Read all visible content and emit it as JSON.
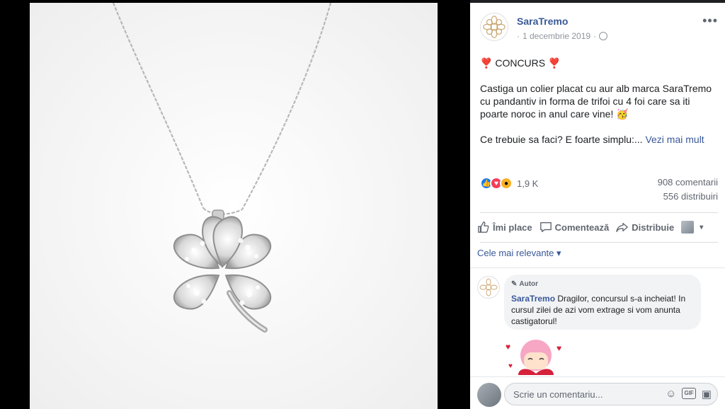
{
  "post": {
    "author": "SaraTremo",
    "date": "1 decembrie 2019",
    "more_icon": "•••",
    "heart_emoji": "❣️",
    "contest_title": "CONCURS",
    "paragraph1": "Castiga un colier placat cu aur alb marca SaraTremo cu pandantiv in forma de trifoi cu 4 foi care sa iti poarte noroc in anul care vine! 🥳",
    "paragraph2": "Ce trebuie sa faci? E foarte simplu:...",
    "see_more": "Vezi mai mult"
  },
  "stats": {
    "reactions_count": "1,9 K",
    "comments": "908 comentarii",
    "shares": "556 distribuiri"
  },
  "actions": {
    "like": "Îmi place",
    "comment": "Comentează",
    "share": "Distribuie",
    "audience_caret": "▾"
  },
  "comments": {
    "sort_label": "Cele mai relevante",
    "sort_caret": "▾",
    "items": [
      {
        "badge": "Autor",
        "author": "SaraTremo",
        "text": "Dragilor, concursul s-a incheiat! In cursul zilei de azi vom extrage si vom anunta castigatorul!"
      }
    ]
  },
  "composer": {
    "placeholder": "Scrie un comentariu...",
    "icons": [
      "emoji-icon",
      "gif-icon",
      "sticker-icon"
    ]
  },
  "colors": {
    "link_blue": "#385898",
    "like_blue": "#1877f2",
    "love_red": "#f33e58",
    "wow_yellow": "#f7b125"
  }
}
